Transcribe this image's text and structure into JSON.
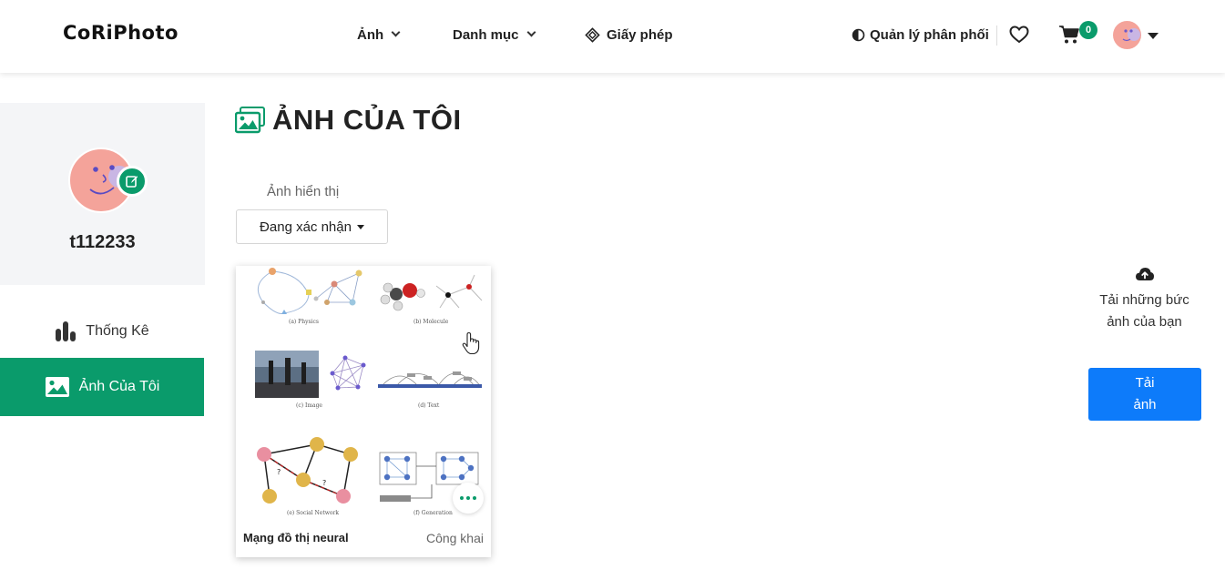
{
  "header": {
    "logo": "CoRiPhoto",
    "nav": {
      "photos_label": "Ảnh",
      "categories_label": "Danh mục",
      "license_label": "Giấy phép"
    },
    "distribution_label": "Quản lý phân phối",
    "cart_count": "0",
    "icons": [
      "diamond-icon",
      "half-shield-icon",
      "heart-icon",
      "cart-icon",
      "avatar",
      "caret-down-icon"
    ]
  },
  "sidebar": {
    "username": "t112233",
    "items": [
      {
        "label": "Thống Kê",
        "icon": "bar-chart-icon",
        "active": false
      },
      {
        "label": "Ảnh Của Tôi",
        "icon": "image-icon",
        "active": true
      }
    ]
  },
  "main": {
    "title": "ẢNH CỦA TÔI",
    "filter": {
      "label": "Ảnh hiển thị",
      "selected": "Đang xác nhận"
    },
    "photos": [
      {
        "name": "Mạng đồ thị neural",
        "visibility": "Công khai",
        "subfigure_captions": [
          "(a) Physics",
          "(b) Molecule",
          "(c) Image",
          "(d) Text",
          "(e) Social Network",
          "(f) Generation"
        ]
      }
    ],
    "upload": {
      "prompt": "Tải những bức ảnh của bạn",
      "button_label": "Tải ảnh"
    }
  },
  "colors": {
    "accent_green": "#0a9b6b",
    "upload_blue": "#0d7bfa",
    "sidebar_bg": "#f4f5f7"
  }
}
